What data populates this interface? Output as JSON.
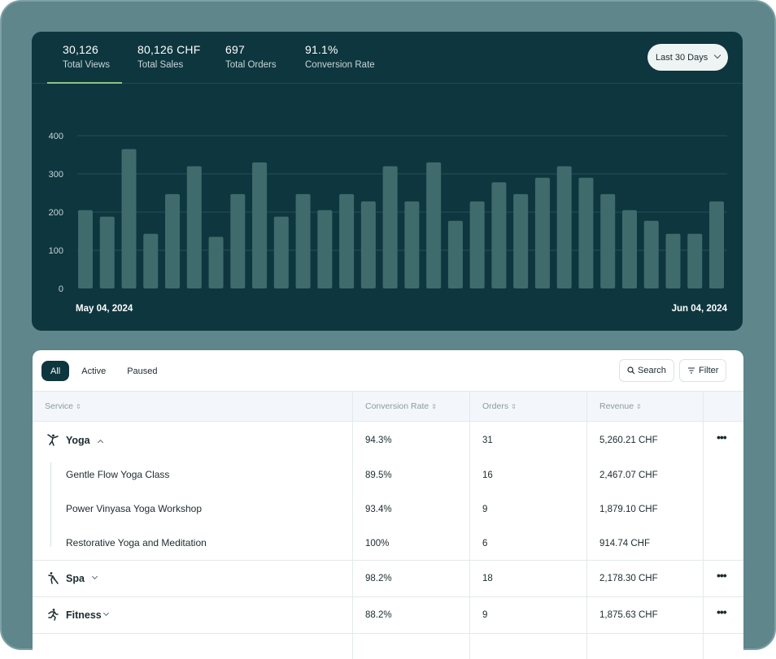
{
  "stats": [
    {
      "value": "30,126",
      "label": "Total Views"
    },
    {
      "value": "80,126 CHF",
      "label": "Total Sales"
    },
    {
      "value": "697",
      "label": "Total Orders"
    },
    {
      "value": "91.1%",
      "label": "Conversion Rate"
    }
  ],
  "date_range": "Last 30 Days",
  "chart_data": {
    "type": "bar",
    "title": "",
    "xlabel": "",
    "ylabel": "",
    "ylim": [
      0,
      400
    ],
    "yticks": [
      "400",
      "300",
      "200",
      "100",
      "0"
    ],
    "x_start_label": "May 04, 2024",
    "x_end_label": "Jun 04, 2024",
    "values": [
      205,
      188,
      365,
      143,
      247,
      320,
      135,
      247,
      330,
      188,
      247,
      205,
      247,
      228,
      320,
      228,
      330,
      177,
      228,
      278,
      247,
      290,
      320,
      290,
      247,
      205,
      177,
      143,
      143,
      228
    ],
    "grid": true,
    "bar_color": "#3f6b6d"
  },
  "tabs": [
    {
      "label": "All",
      "active": true
    },
    {
      "label": "Active",
      "active": false
    },
    {
      "label": "Paused",
      "active": false
    }
  ],
  "toolbar": {
    "search_label": "Search",
    "filter_label": "Filter"
  },
  "columns": [
    "Service",
    "Conversion Rate",
    "Orders",
    "Revenue"
  ],
  "groups": {
    "yoga": {
      "name": "Yoga",
      "rate": "94.3%",
      "orders": "31",
      "revenue": "5,260.21 CHF",
      "children": [
        {
          "name": "Gentle Flow Yoga Class",
          "rate": "89.5%",
          "orders": "16",
          "revenue": "2,467.07 CHF"
        },
        {
          "name": "Power Vinyasa Yoga Workshop",
          "rate": "93.4%",
          "orders": "9",
          "revenue": "1,879.10 CHF"
        },
        {
          "name": "Restorative Yoga and Meditation",
          "rate": "100%",
          "orders": "6",
          "revenue": "914.74 CHF"
        }
      ]
    },
    "spa": {
      "name": "Spa",
      "rate": "98.2%",
      "orders": "18",
      "revenue": "2,178.30 CHF"
    },
    "fitness": {
      "name": "Fitness",
      "rate": "88.2%",
      "orders": "9",
      "revenue": "1,875.63 CHF"
    }
  }
}
